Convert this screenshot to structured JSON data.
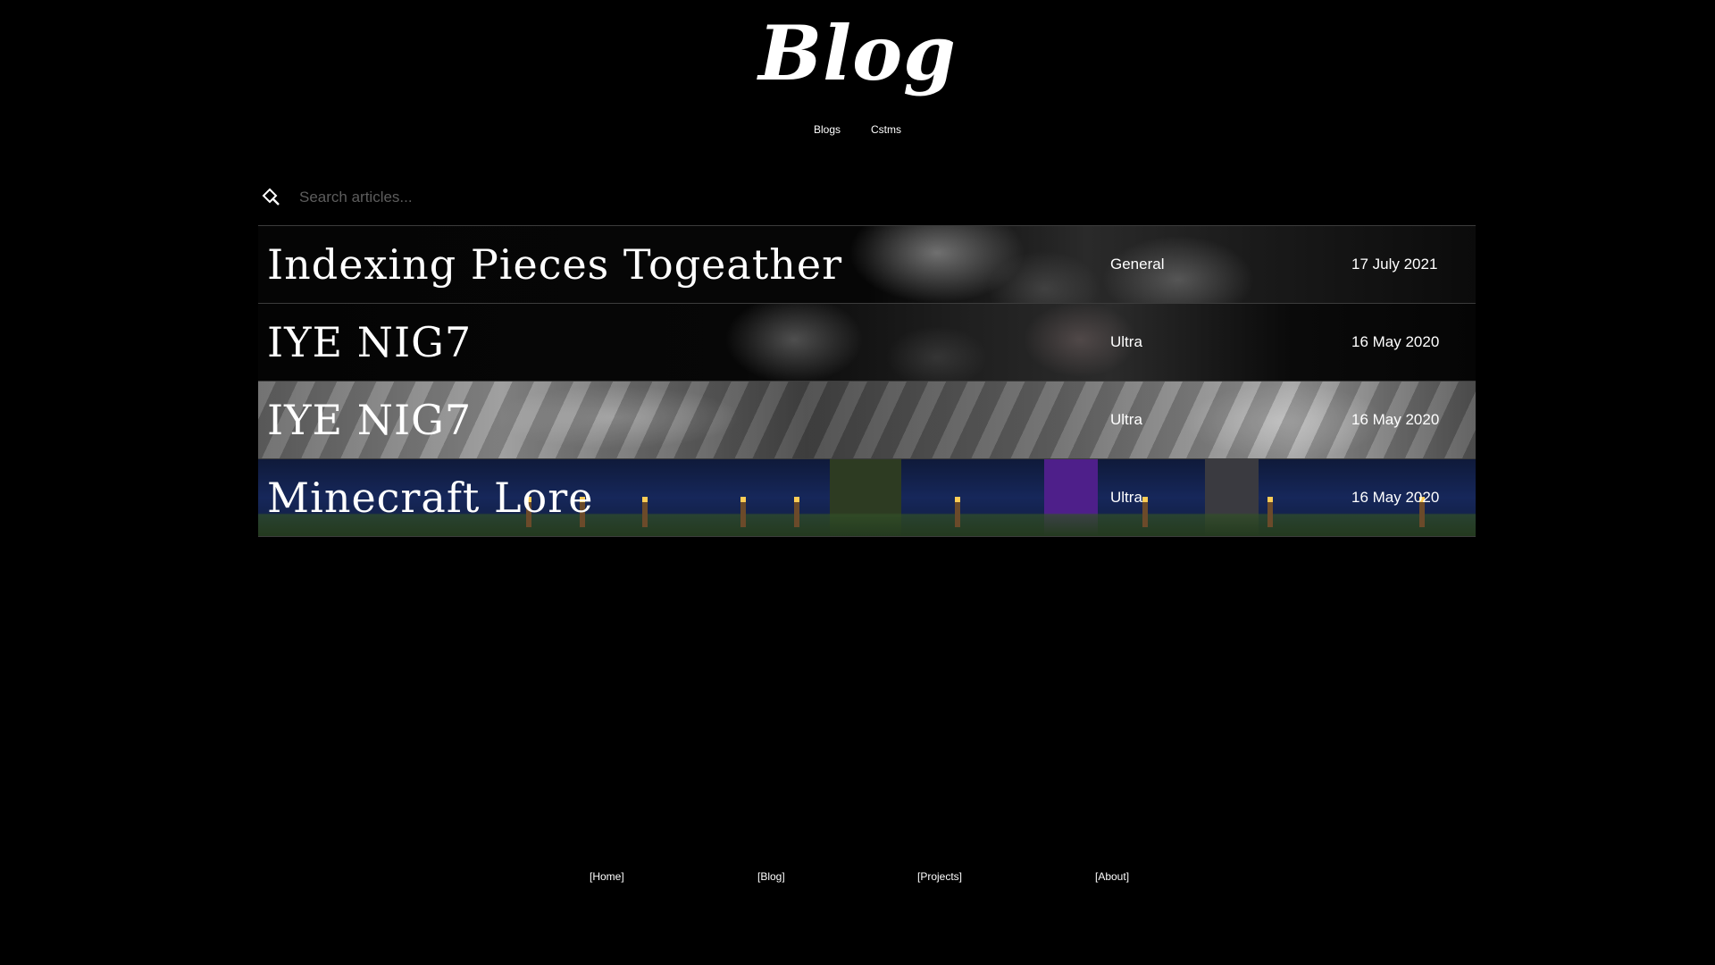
{
  "header": {
    "logo": "Blog",
    "subnav": [
      "Blogs",
      "Cstms"
    ]
  },
  "search": {
    "icon": "search-icon",
    "placeholder": "Search articles..."
  },
  "articles": [
    {
      "title": "Indexing Pieces Togeather",
      "category": "General",
      "date": "17 July 2021"
    },
    {
      "title": "IYE NIG7",
      "category": "Ultra",
      "date": "16 May 2020"
    },
    {
      "title": "IYE NIG7",
      "category": "Ultra",
      "date": "16 May 2020"
    },
    {
      "title": "Minecraft Lore",
      "category": "Ultra",
      "date": "16 May 2020"
    }
  ],
  "footer": {
    "links": [
      "[Home]",
      "[Blog]",
      "[Projects]",
      "[About]"
    ]
  }
}
